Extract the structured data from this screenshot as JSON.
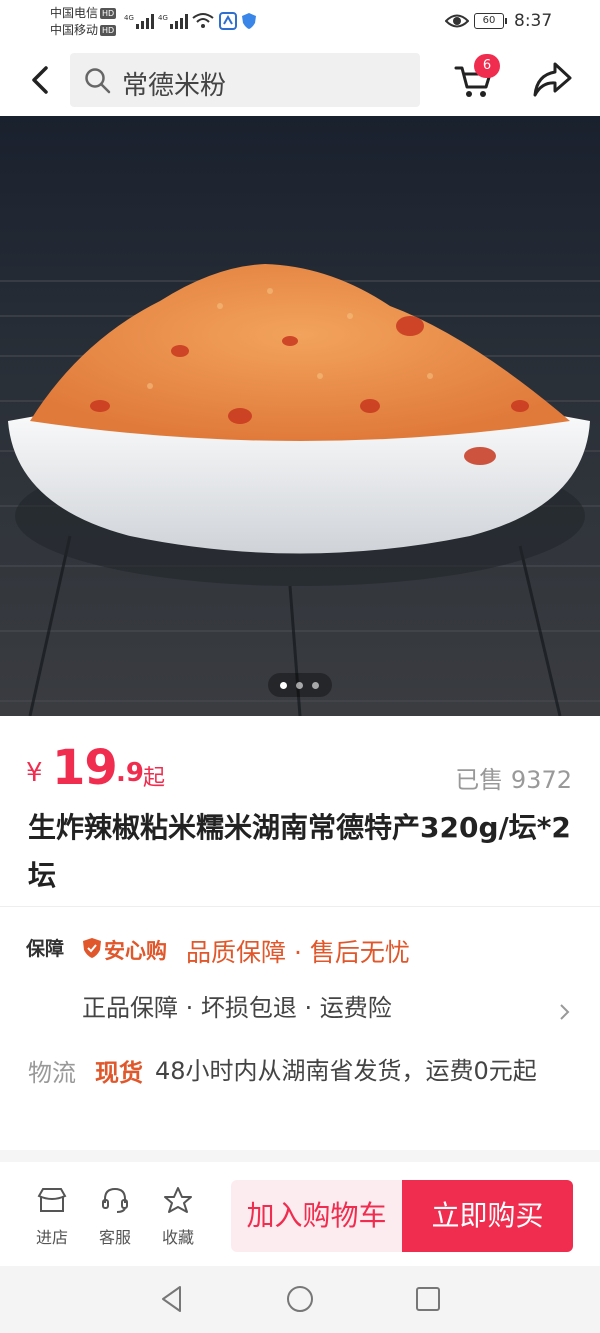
{
  "status_bar": {
    "carrier_1": "中国电信",
    "carrier_2": "中国移动",
    "hd_badge": "HD",
    "net_type": "4G",
    "battery": "60",
    "time": "8:37"
  },
  "navbar": {
    "search_text": "常德米粉",
    "cart_count": "6"
  },
  "gallery": {
    "image_count": 3,
    "active_index": 0
  },
  "price": {
    "currency": "¥",
    "integer": "19",
    "decimal": ".9",
    "suffix": "起",
    "sold_label": "已售 9372"
  },
  "product": {
    "title": "生炸辣椒粘米糯米湖南常德特产320g/坛*2坛"
  },
  "guarantee": {
    "label": "保障",
    "brand": "安心购",
    "headline": "品质保障 · 售后无忧",
    "items": "正品保障 · 坏损包退 · 运费险"
  },
  "logistics": {
    "label": "物流",
    "stock_tag": "现货",
    "detail": "48小时内从湖南省发货，运费0元起"
  },
  "actions": {
    "store": "进店",
    "service": "客服",
    "favorite": "收藏",
    "add_to_cart": "加入购物车",
    "buy_now": "立即购买"
  },
  "colors": {
    "accent": "#f02d4f",
    "guarantee": "#e0572b"
  }
}
